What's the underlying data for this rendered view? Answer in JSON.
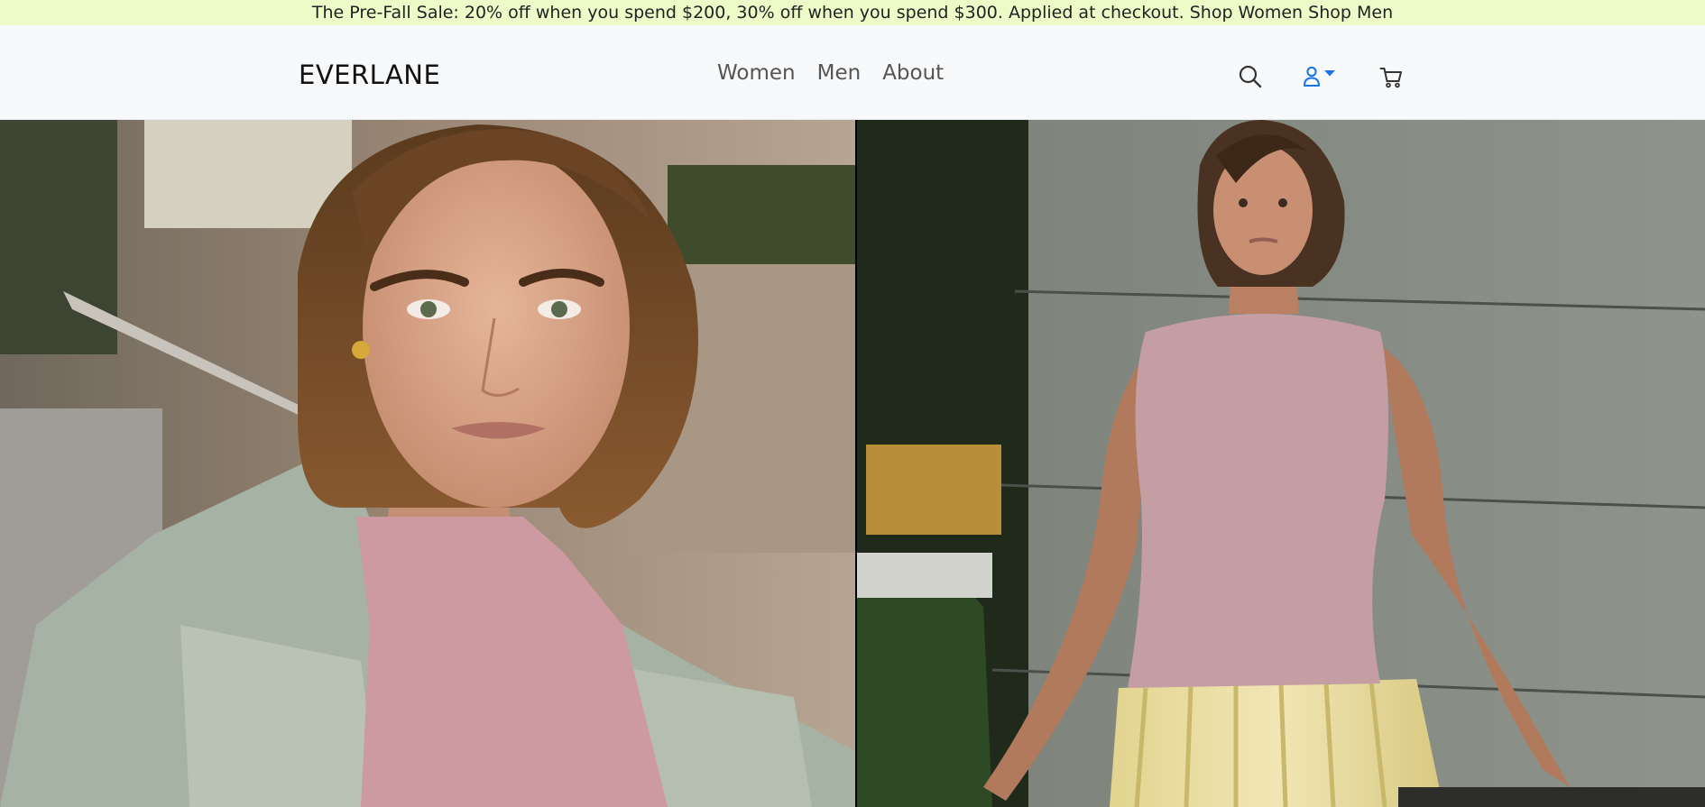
{
  "promo": {
    "text": "The Pre-Fall Sale: 20% off when you spend $200, 30% off when you spend $300. Applied at checkout.",
    "shop_women": "Shop Women",
    "shop_men": "Shop Men"
  },
  "header": {
    "logo": "EVERLANE",
    "nav": [
      {
        "label": "Women"
      },
      {
        "label": "Men"
      },
      {
        "label": "About"
      }
    ],
    "icons": {
      "search": "search-icon",
      "account": "user-icon",
      "account_dropdown": "caret-down-icon",
      "cart": "cart-icon"
    },
    "accent_color": "#1a73e8"
  },
  "hero": {
    "left_image": "Woman with short bob wearing pink ribbed top and sage blazer",
    "right_image": "Woman in pink sleeveless top and yellow plaid pleated skirt against grey wall"
  }
}
